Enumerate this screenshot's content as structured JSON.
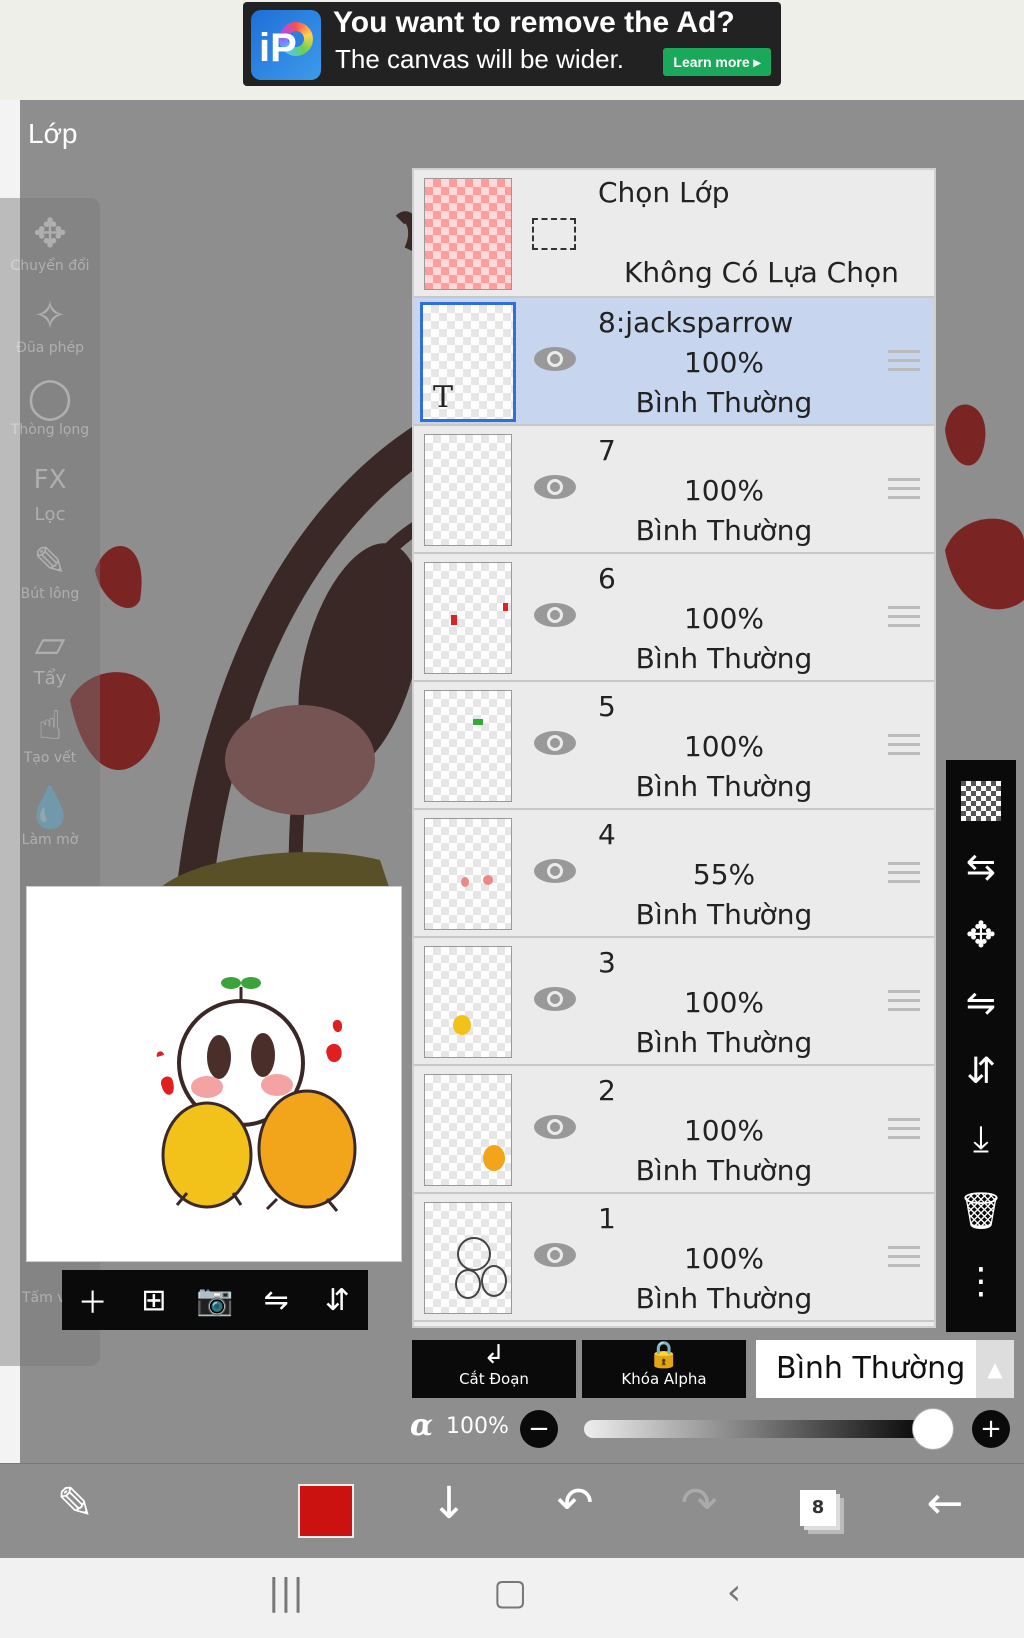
{
  "ad": {
    "title": "You want to remove the Ad?",
    "subtitle": "The canvas will be wider.",
    "learn_more": "Learn more ▸"
  },
  "screen_title": "Lớp",
  "left_tools": [
    {
      "icon": "move-icon",
      "label": "Chuyển đổi"
    },
    {
      "icon": "magic-wand-icon",
      "label": "Đũa phép"
    },
    {
      "icon": "lasso-icon",
      "label": "Thòng lọng"
    },
    {
      "icon": "fx-icon",
      "label": "Lọc"
    },
    {
      "icon": "brush-icon",
      "label": "Bút lông"
    },
    {
      "icon": "eraser-icon",
      "label": "Tẩy"
    },
    {
      "icon": "smudge-icon",
      "label": "Tạo vết"
    },
    {
      "icon": "blur-icon",
      "label": "Làm mờ"
    },
    {
      "icon": "canvas-icon",
      "label": "Tấm vải"
    }
  ],
  "selection_row": {
    "title": "Chọn Lớp",
    "status": "Không Có Lựa Chọn"
  },
  "layers": [
    {
      "name": "8:jacksparrow",
      "opacity": "100%",
      "mode": "Bình Thường",
      "selected": true
    },
    {
      "name": "7",
      "opacity": "100%",
      "mode": "Bình Thường",
      "selected": false
    },
    {
      "name": "6",
      "opacity": "100%",
      "mode": "Bình Thường",
      "selected": false
    },
    {
      "name": "5",
      "opacity": "100%",
      "mode": "Bình Thường",
      "selected": false
    },
    {
      "name": "4",
      "opacity": "55%",
      "mode": "Bình Thường",
      "selected": false
    },
    {
      "name": "3",
      "opacity": "100%",
      "mode": "Bình Thường",
      "selected": false
    },
    {
      "name": "2",
      "opacity": "100%",
      "mode": "Bình Thường",
      "selected": false
    },
    {
      "name": "1",
      "opacity": "100%",
      "mode": "Bình Thường",
      "selected": false
    }
  ],
  "bottom_controls": {
    "clip_label": "Cắt Đoạn",
    "alpha_lock_label": "Khóa Alpha",
    "blend_mode": "Bình Thường",
    "alpha_symbol": "α",
    "alpha_value": "100%",
    "minus": "−",
    "plus": "+"
  },
  "layer_count": "8",
  "colors": {
    "primary_color": "#cc1111",
    "selected_layer_bg": "#c7d6ee",
    "selected_border": "#2f6fd8"
  }
}
